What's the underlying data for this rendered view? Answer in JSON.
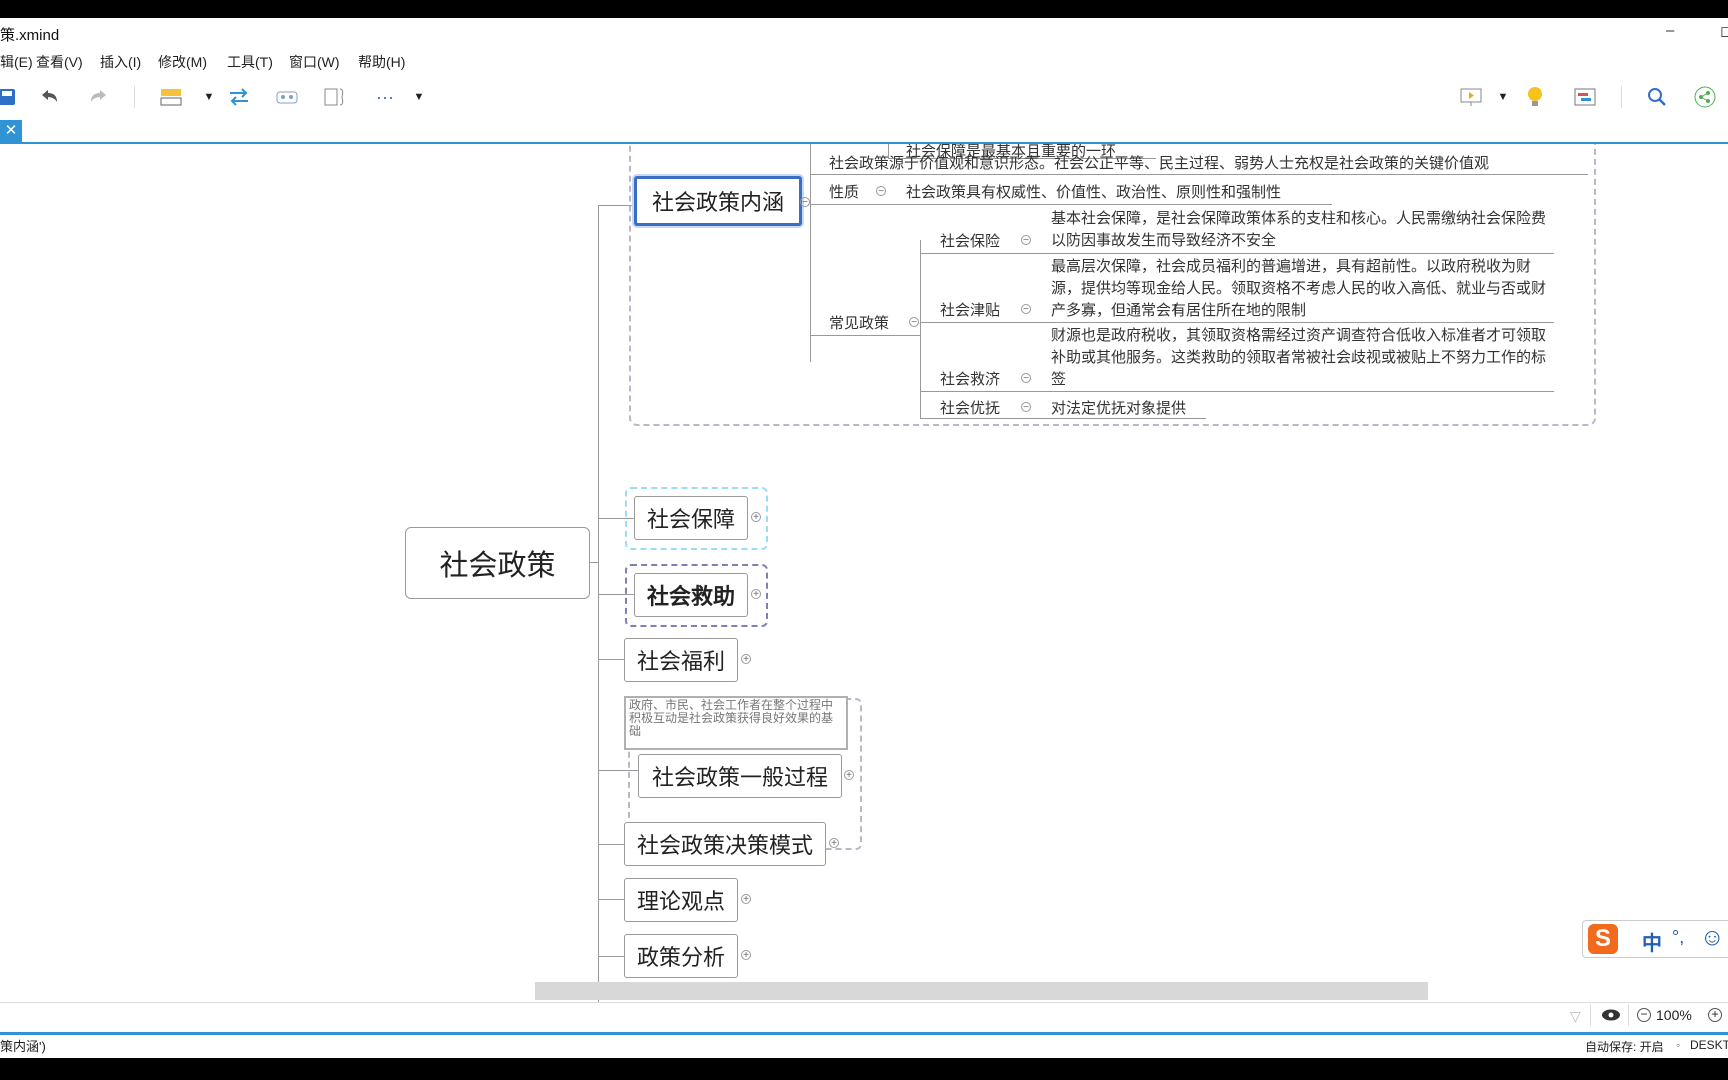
{
  "window": {
    "title": "策.xmind",
    "minimize": "–",
    "restore": "◻"
  },
  "menu": [
    "辑(E)",
    "查看(V)",
    "插入(I)",
    "修改(M)",
    "工具(T)",
    "窗口(W)",
    "帮助(H)"
  ],
  "tab": {
    "close": "✕"
  },
  "mindmap": {
    "central": "社会政策",
    "branch1": {
      "label": "社会政策内涵",
      "cut_text": "社会保障是最基本且重要的一环",
      "rows": [
        {
          "text": "社会政策源于价值观和意识形态。社会公正平等、民主过程、弱势人士充权是社会政策的关键价值观"
        },
        {
          "label": "性质",
          "text": "社会政策具有权威性、价值性、政治性、原则性和强制性"
        }
      ],
      "common": {
        "label": "常见政策",
        "items": [
          {
            "label": "社会保险",
            "text": "基本社会保障，是社会保障政策体系的支柱和核心。人民需缴纳社会保险费以防因事故发生而导致经济不安全"
          },
          {
            "label": "社会津贴",
            "text": "最高层次保障，社会成员福利的普遍增进，具有超前性。以政府税收为财源，提供均等现金给人民。领取资格不考虑人民的收入高低、就业与否或财产多寡，但通常会有居住所在地的限制"
          },
          {
            "label": "社会救济",
            "text": "财源也是政府税收，其领取资格需经过资产调查符合低收入标准者才可领取补助或其他服务。这类救助的领取者常被社会歧视或被贴上不努力工作的标签"
          },
          {
            "label": "社会优抚",
            "text": "对法定优抚对象提供"
          }
        ]
      }
    },
    "branches": [
      "社会保障",
      "社会救助",
      "社会福利",
      "社会政策一般过程",
      "社会政策决策模式",
      "理论观点",
      "政策分析"
    ],
    "note": "政府、市民、社会工作者在整个过程中积极互动是社会政策获得良好效果的基础"
  },
  "ime": {
    "mode": "中",
    "punct": "°,",
    "emoji": "☺"
  },
  "status": {
    "zoom": "100%",
    "minus": "−",
    "plus": "+"
  },
  "info": {
    "left": "策内涵')",
    "autosave": "自动保存: 开启",
    "machine": "DESKT"
  },
  "colors": {
    "accent": "#2f93d6",
    "selected": "#3a6ec6"
  }
}
